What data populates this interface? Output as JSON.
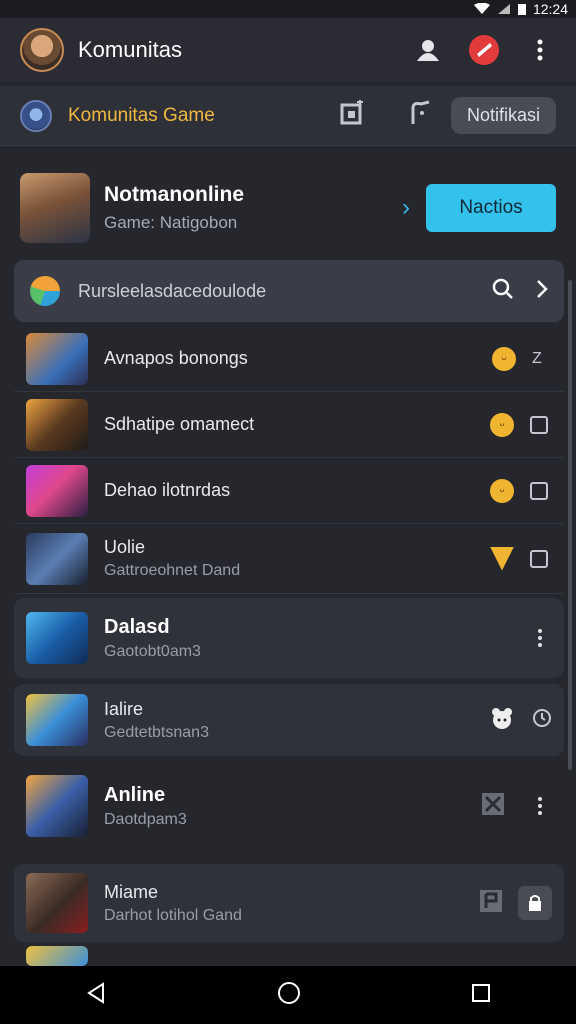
{
  "status_bar": {
    "time": "12:24"
  },
  "app_bar": {
    "title": "Komunitas"
  },
  "sub_bar": {
    "title": "Komunitas Game",
    "notif_label": "Notifikasi"
  },
  "profile": {
    "name": "Notmanonline",
    "subtitle": "Game: Natigobon",
    "action_label": "Nactios"
  },
  "search_card": {
    "label": "Rursleelasdacedoulode"
  },
  "list": [
    {
      "title": "Avnapos bonongs",
      "sub": ""
    },
    {
      "title": "Sdhatipe omamect",
      "sub": ""
    },
    {
      "title": "Dehao ilotnrdas",
      "sub": ""
    },
    {
      "title": "Uolie",
      "sub": "Gattroeohnet Dand"
    },
    {
      "title": "Dalasd",
      "sub": "Gaotobt0am3"
    },
    {
      "title": "Ialire",
      "sub": "Gedtetbtsnan3"
    },
    {
      "title": "Anline",
      "sub": "Daotdpam3"
    },
    {
      "title": "Miame",
      "sub": "Darhot lotihol Gand"
    }
  ],
  "colors": {
    "accent": "#33c2ec",
    "gold": "#f0b530",
    "bg": "#26272d"
  }
}
